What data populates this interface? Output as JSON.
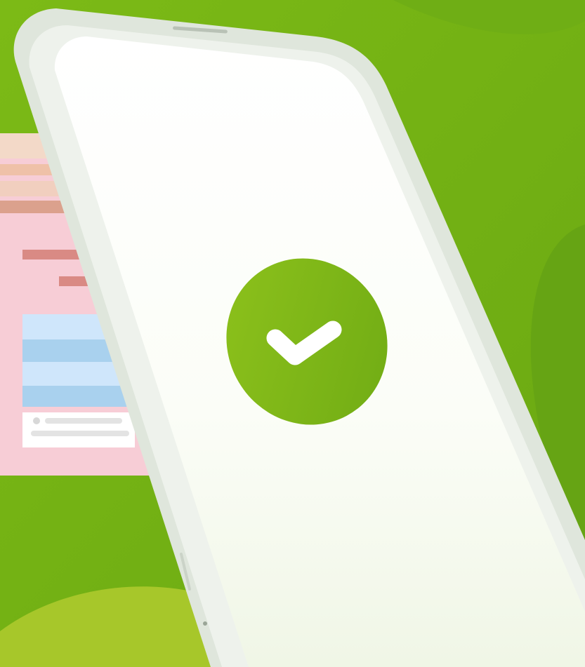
{
  "scene": {
    "kind": "illustration",
    "confirmation_icon": "checkmark-icon",
    "colors": {
      "background": "#74b414",
      "background_light": "#a6c928",
      "blob_dark": "#6aa815",
      "card_pink": "#f7cdd6",
      "card_bar_red": "#d98a84",
      "card_bar_peach": "#efc1a8",
      "card_block_blue_light": "#cfe6fb",
      "card_block_blue": "#a9d1ee",
      "phone_frame": "#e2e8df",
      "phone_screen": "#ffffff",
      "check_circle": "#7fb81a",
      "check_mark": "#ffffff"
    }
  }
}
